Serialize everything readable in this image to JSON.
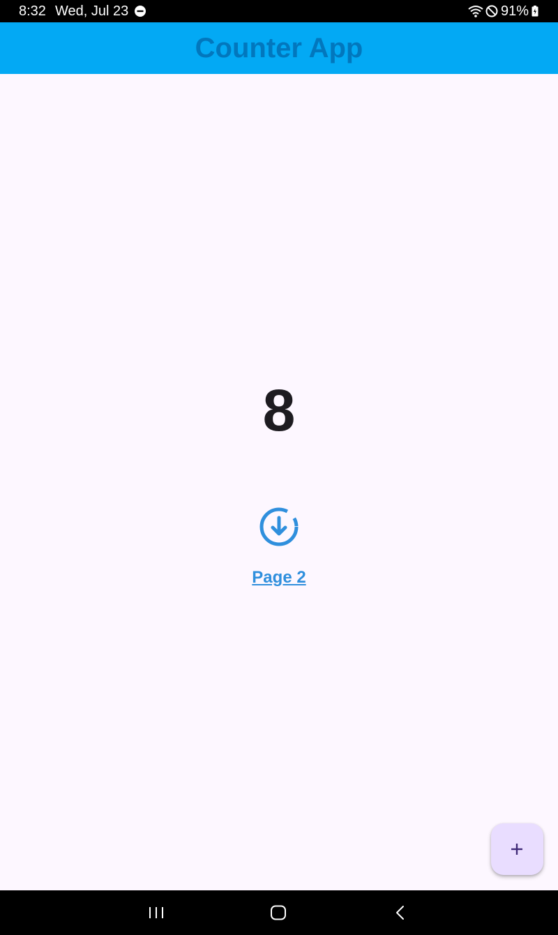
{
  "status_bar": {
    "time": "8:32",
    "date": "Wed, Jul 23",
    "battery": "91%",
    "icons": [
      "do-not-disturb-icon",
      "wifi-icon",
      "blocked-icon",
      "battery-icon"
    ]
  },
  "app_bar": {
    "title": "Counter App",
    "background": "#03A9F4",
    "title_color": "#0277BD"
  },
  "main": {
    "counter": "8",
    "link_icon": "download-circle-icon",
    "link_label": "Page 2",
    "link_color": "#2F8FDD",
    "background": "#FDF7FF"
  },
  "fab": {
    "icon": "plus-icon",
    "background": "#E9DDFF"
  },
  "nav_bar": {
    "buttons": [
      "recent-apps-icon",
      "home-icon",
      "back-icon"
    ]
  }
}
